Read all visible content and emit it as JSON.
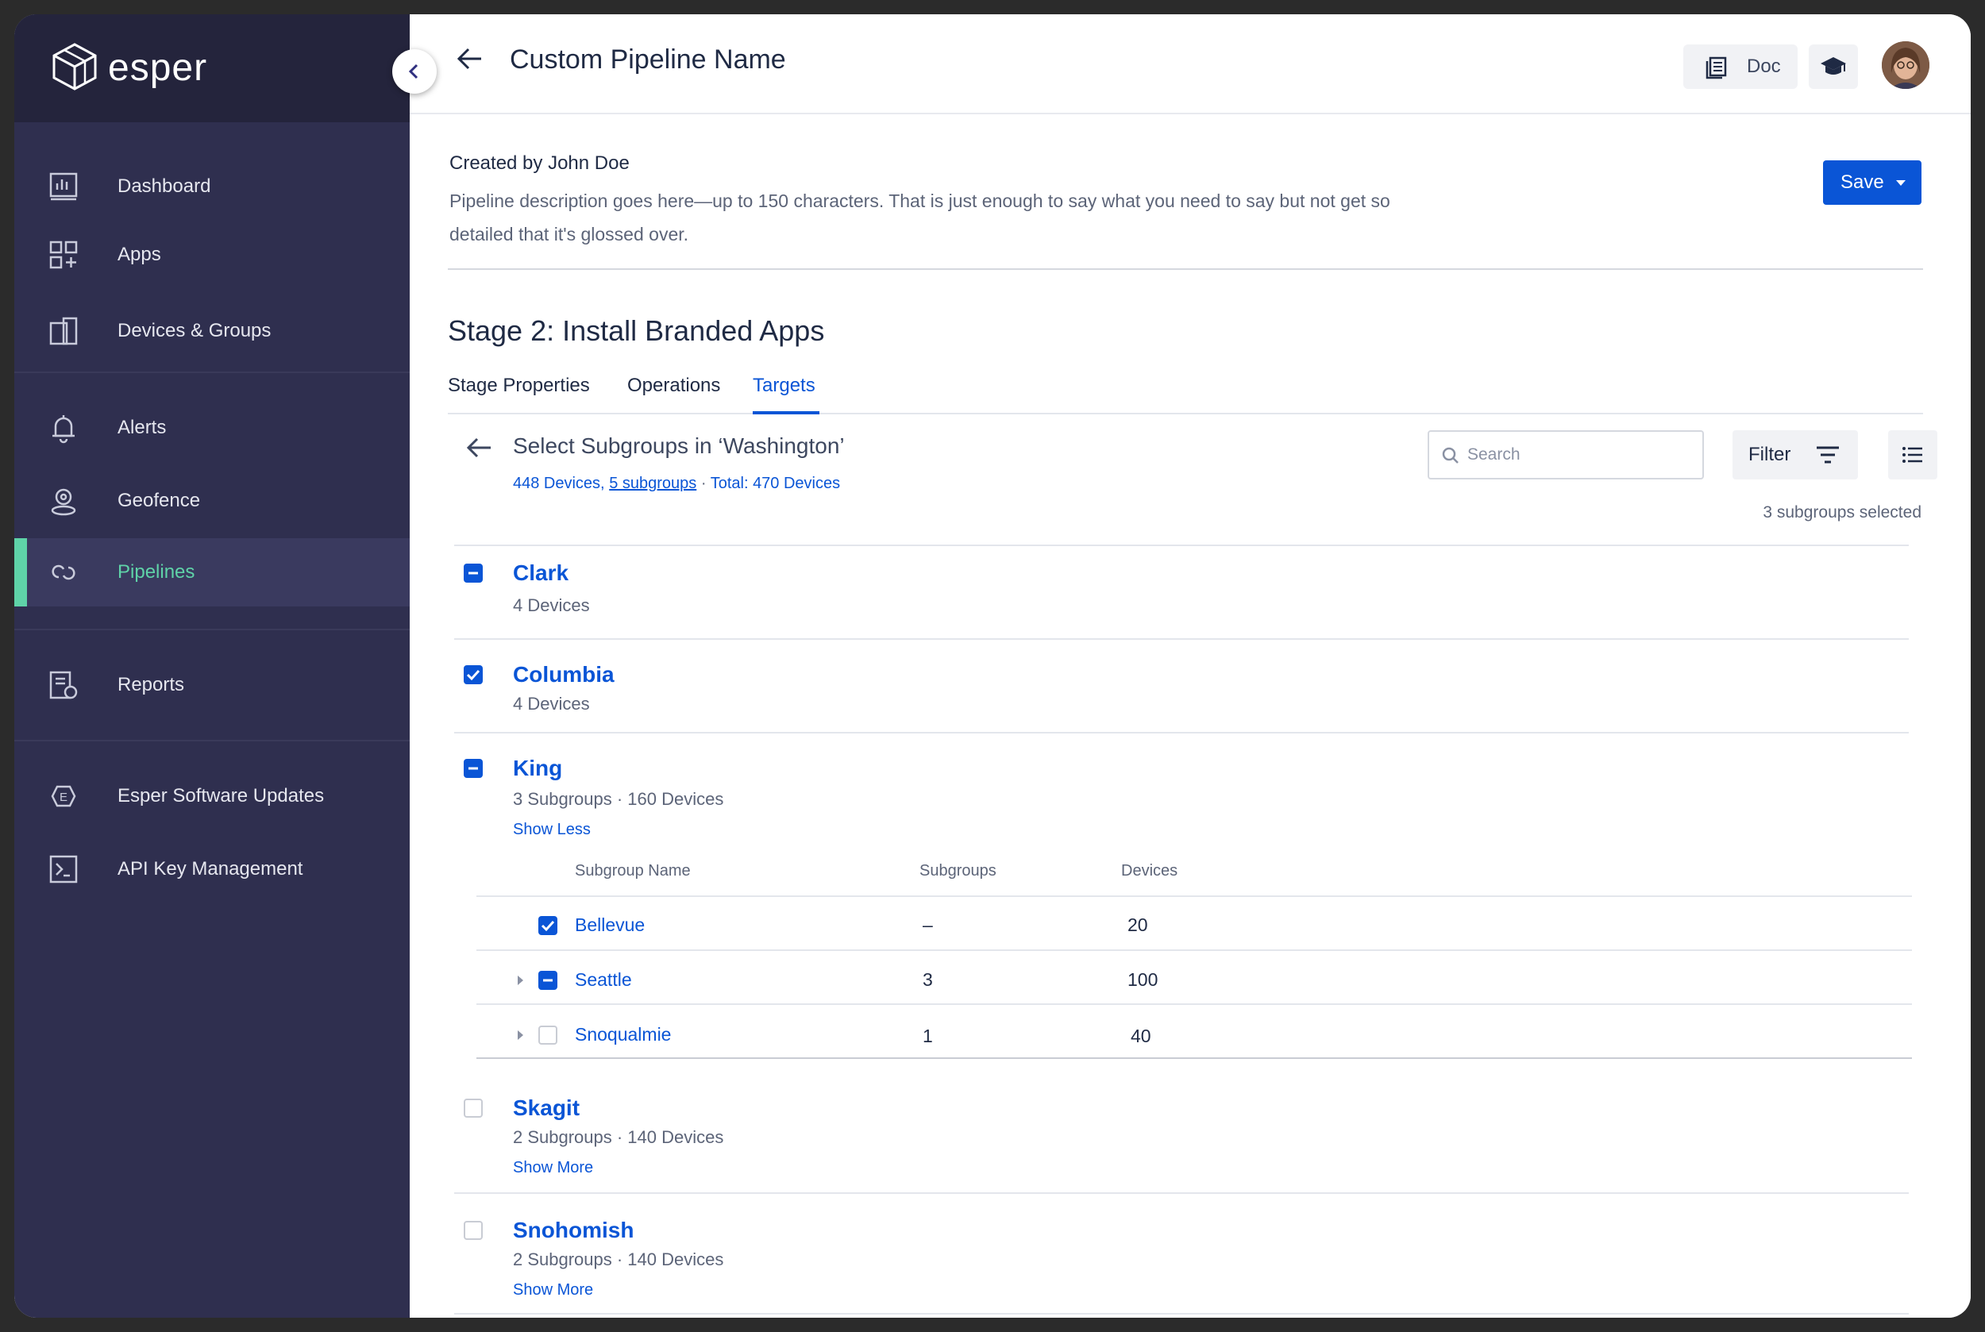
{
  "brand": {
    "name": "esper"
  },
  "sidebar": {
    "items": [
      {
        "label": "Dashboard",
        "icon": "dashboard-icon"
      },
      {
        "label": "Apps",
        "icon": "apps-icon"
      },
      {
        "label": "Devices & Groups",
        "icon": "devices-icon"
      },
      {
        "label": "Alerts",
        "icon": "bell-icon"
      },
      {
        "label": "Geofence",
        "icon": "geofence-icon"
      },
      {
        "label": "Pipelines",
        "icon": "pipelines-icon",
        "active": true
      },
      {
        "label": "Reports",
        "icon": "reports-icon"
      },
      {
        "label": "Esper Software Updates",
        "icon": "software-updates-icon"
      },
      {
        "label": "API Key Management",
        "icon": "terminal-icon"
      }
    ]
  },
  "header": {
    "title": "Custom Pipeline Name",
    "doc_label": "Doc"
  },
  "pipeline": {
    "created_by": "Created by John Doe",
    "description": "Pipeline description goes here—up to 150 characters. That is just enough to say what you need to say but not get so detailed that it's glossed over.",
    "save_label": "Save"
  },
  "stage": {
    "title": "Stage 2: Install Branded Apps",
    "tabs": [
      "Stage Properties",
      "Operations",
      "Targets"
    ],
    "active_tab": "Targets"
  },
  "targets": {
    "title": "Select Subgroups in ‘Washington’",
    "devices": "448 Devices,",
    "subgroups_link": "5 subgroups",
    "dot": "·",
    "total": "Total: 470 Devices",
    "search_placeholder": "Search",
    "filter_label": "Filter",
    "selected_count": "3 subgroups selected"
  },
  "groups": [
    {
      "name": "Clark",
      "meta": "4 Devices",
      "state": "partial"
    },
    {
      "name": "Columbia",
      "meta": "4 Devices",
      "state": "checked"
    },
    {
      "name": "King",
      "meta": "3 Subgroups  · 160 Devices",
      "state": "partial",
      "link": "Show Less"
    },
    {
      "name": "Skagit",
      "meta": "2 Subgroups  ·  140 Devices",
      "state": "unchecked",
      "link": "Show More"
    },
    {
      "name": "Snohomish",
      "meta": "2 Subgroups  ·  140 Devices",
      "state": "unchecked",
      "link": "Show More"
    }
  ],
  "subtable": {
    "headers": [
      "Subgroup Name",
      "Subgroups",
      "Devices"
    ],
    "rows": [
      {
        "name": "Bellevue",
        "subgroups": "–",
        "devices": "20",
        "state": "checked"
      },
      {
        "name": "Seattle",
        "subgroups": "3",
        "devices": "100",
        "state": "partial"
      },
      {
        "name": "Snoqualmie",
        "subgroups": "1",
        "devices": "40",
        "state": "unchecked"
      }
    ]
  },
  "colors": {
    "accent": "#0a55d6",
    "active_nav": "#5fd3a8",
    "sidebar_bg": "#2f2f4f"
  }
}
